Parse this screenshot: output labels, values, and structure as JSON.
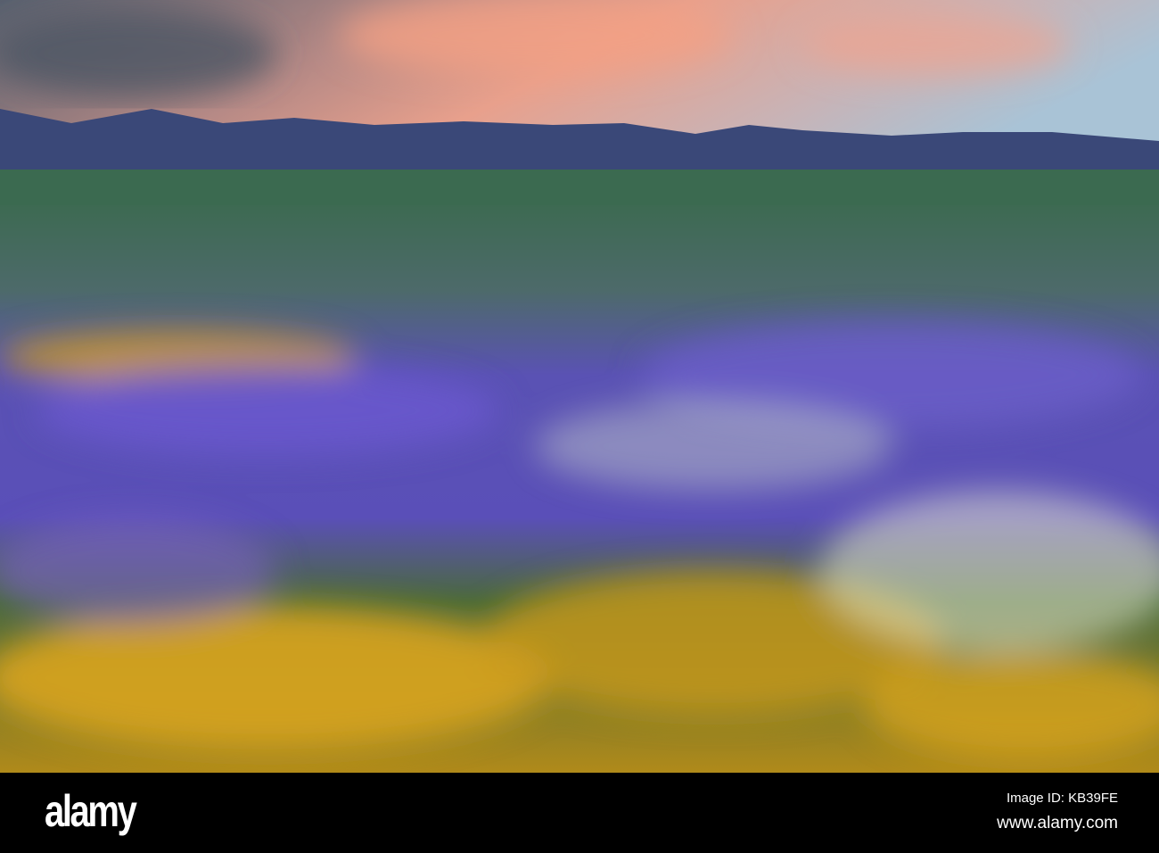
{
  "photo": {
    "subject": "wildflower-field-with-mountains",
    "colors": {
      "sky_top": "#5d6877",
      "cloud_pink": "#f0a48a",
      "sky_right": "#a9c3d6",
      "mountain": "#3b4a7a",
      "plain": "#3e6b50",
      "purple_flowers": "#6a5bc4",
      "yellow_flowers": "#d9a41d",
      "white_flowers": "#e8ecd2"
    }
  },
  "watermark": {
    "logo": "alamy",
    "image_id": "Image ID: KB39FE",
    "url": "www.alamy.com"
  }
}
